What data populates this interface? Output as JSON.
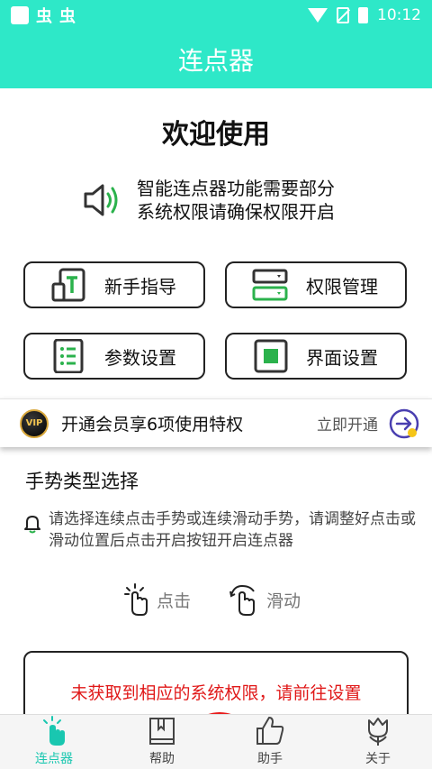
{
  "status_bar": {
    "app_icons": [
      "虫",
      "虫"
    ],
    "time": "10:12"
  },
  "header": {
    "title": "连点器"
  },
  "welcome": {
    "title": "欢迎使用"
  },
  "notice": {
    "line1": "智能连点器功能需要部分",
    "line2": "系统权限请确保权限开启"
  },
  "actions": [
    {
      "label": "新手指导",
      "icon": "guide-icon"
    },
    {
      "label": "权限管理",
      "icon": "permissions-icon"
    },
    {
      "label": "参数设置",
      "icon": "parameters-icon"
    },
    {
      "label": "界面设置",
      "icon": "interface-icon"
    }
  ],
  "vip": {
    "badge": "VIP",
    "text": "开通会员享6项使用特权",
    "cta": "立即开通"
  },
  "gesture": {
    "title": "手势类型选择",
    "hint": "请选择连续点击手势或连续滑动手势，请调整好点击或滑动位置后点击开启按钮开启连点器",
    "click_label": "点击",
    "swipe_label": "滑动"
  },
  "warning": {
    "text": "未获取到相应的系统权限，请前往设置"
  },
  "bottom_nav": [
    {
      "label": "连点器",
      "active": true
    },
    {
      "label": "帮助",
      "active": false
    },
    {
      "label": "助手",
      "active": false
    },
    {
      "label": "关于",
      "active": false
    }
  ],
  "colors": {
    "accent": "#2ee8c8",
    "nav_active": "#19c7b0",
    "warning": "#e01818",
    "icon_green": "#2bb24c"
  }
}
